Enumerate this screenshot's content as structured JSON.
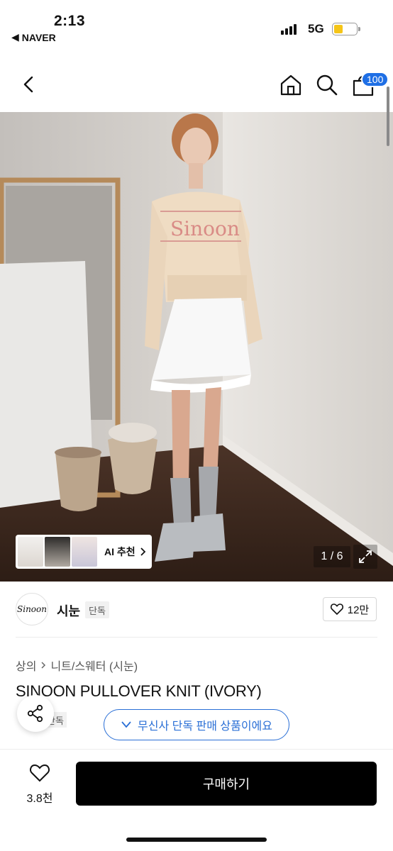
{
  "status_bar": {
    "time": "2:13",
    "back_app": "NAVER",
    "network": "5G",
    "battery_level": 0.4
  },
  "nav": {
    "cart_count": "100"
  },
  "hero": {
    "ai_recommend": "AI 추천",
    "image_counter": "1 / 6"
  },
  "brand": {
    "logo_text": "Sinoon",
    "name": "시눈",
    "tag": "단독",
    "likes": "12만"
  },
  "product": {
    "breadcrumb_category": "상의",
    "breadcrumb_sub": "니트/스웨터 (시눈)",
    "title": "SINOON PULLOVER KNIT (IVORY)",
    "exclusive_tag": "단독",
    "exclusive_notice": "무신사 단독 판매 상품이에요"
  },
  "bottom": {
    "wishlist_count": "3.8천",
    "buy_label": "구매하기"
  },
  "colors": {
    "accent_blue": "#2a6fd6",
    "badge_blue": "#1f6fe5",
    "buy_button": "#000000"
  },
  "icons": [
    "back-chevron-icon",
    "home-icon",
    "search-icon",
    "shopping-bag-icon",
    "expand-icon",
    "heart-icon",
    "share-icon",
    "check-icon",
    "chevron-right-icon"
  ]
}
